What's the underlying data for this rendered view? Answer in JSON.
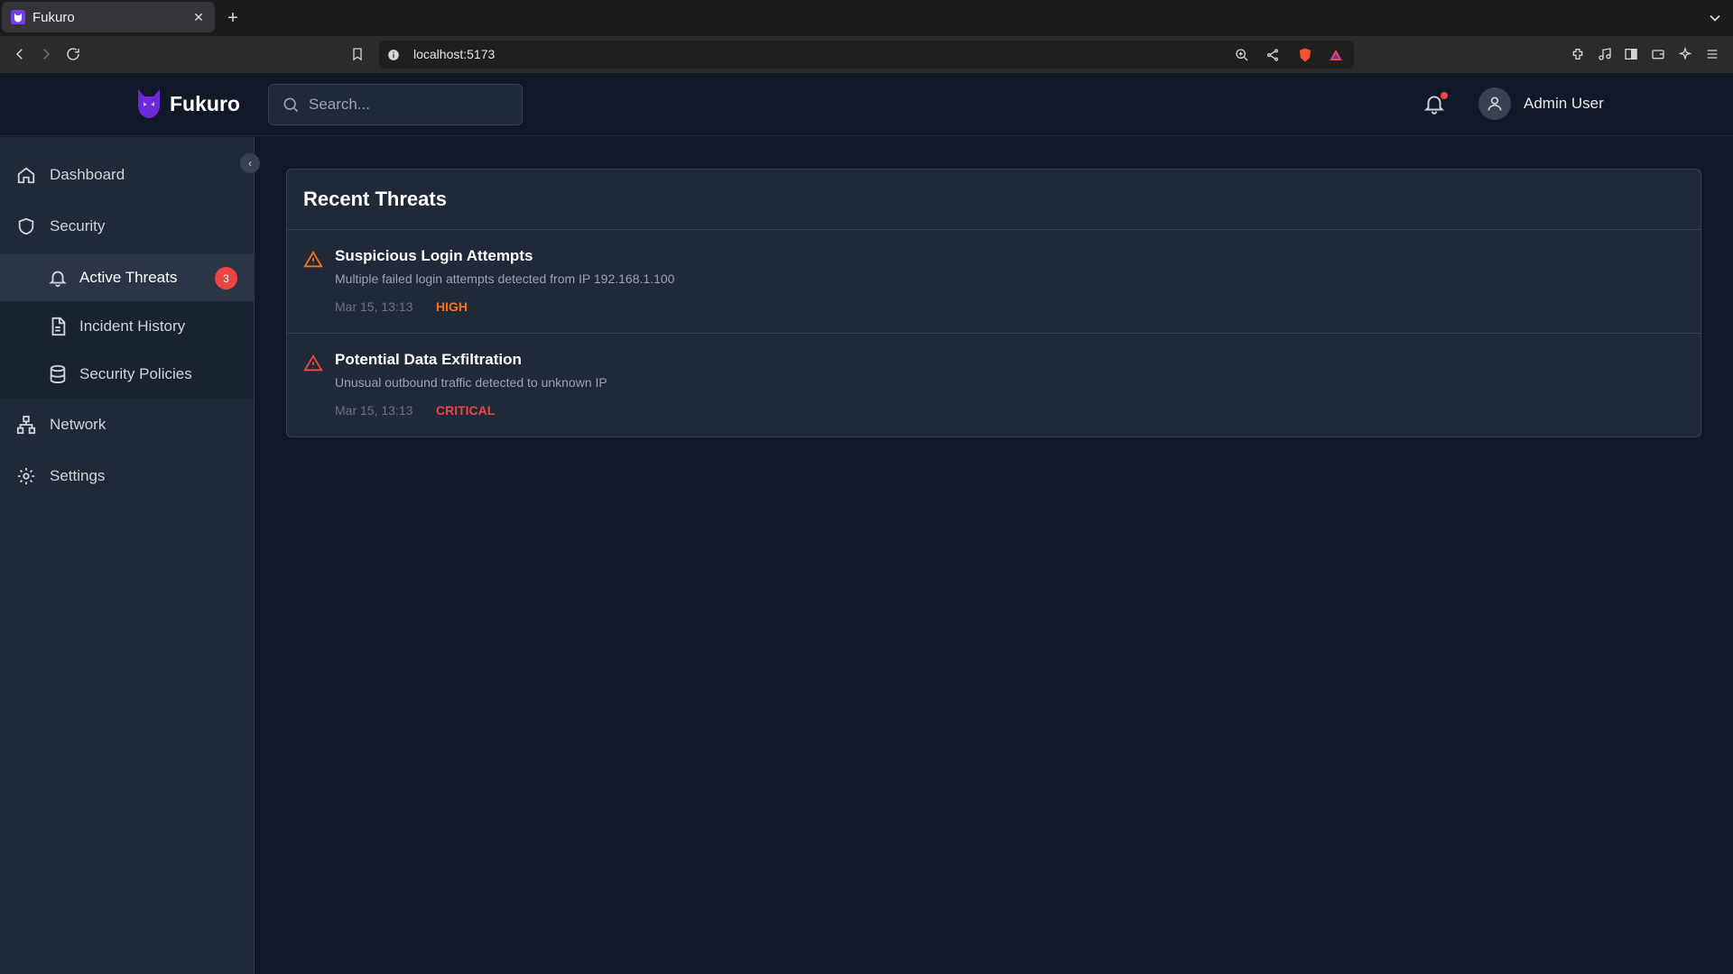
{
  "browser": {
    "tab_title": "Fukuro",
    "url": "localhost:5173"
  },
  "header": {
    "brand": "Fukuro",
    "search_placeholder": "Search...",
    "user_name": "Admin User"
  },
  "sidebar": {
    "items": [
      {
        "label": "Dashboard",
        "icon": "home-icon"
      },
      {
        "label": "Security",
        "icon": "shield-icon"
      },
      {
        "label": "Network",
        "icon": "network-icon"
      },
      {
        "label": "Settings",
        "icon": "gear-icon"
      }
    ],
    "security_submenu": [
      {
        "label": "Active Threats",
        "icon": "bell-icon",
        "badge": "3",
        "active": true
      },
      {
        "label": "Incident History",
        "icon": "document-icon"
      },
      {
        "label": "Security Policies",
        "icon": "database-icon"
      }
    ]
  },
  "main": {
    "card_title": "Recent Threats",
    "threats": [
      {
        "title": "Suspicious Login Attempts",
        "description": "Multiple failed login attempts detected from IP 192.168.1.100",
        "time": "Mar 15, 13:13",
        "severity": "HIGH",
        "severity_color": "#f97316"
      },
      {
        "title": "Potential Data Exfiltration",
        "description": "Unusual outbound traffic detected to unknown IP",
        "time": "Mar 15, 13:13",
        "severity": "CRITICAL",
        "severity_color": "#ef4444"
      }
    ]
  },
  "colors": {
    "accent": "#7c3aed",
    "danger": "#ef4444",
    "warning": "#f97316"
  }
}
